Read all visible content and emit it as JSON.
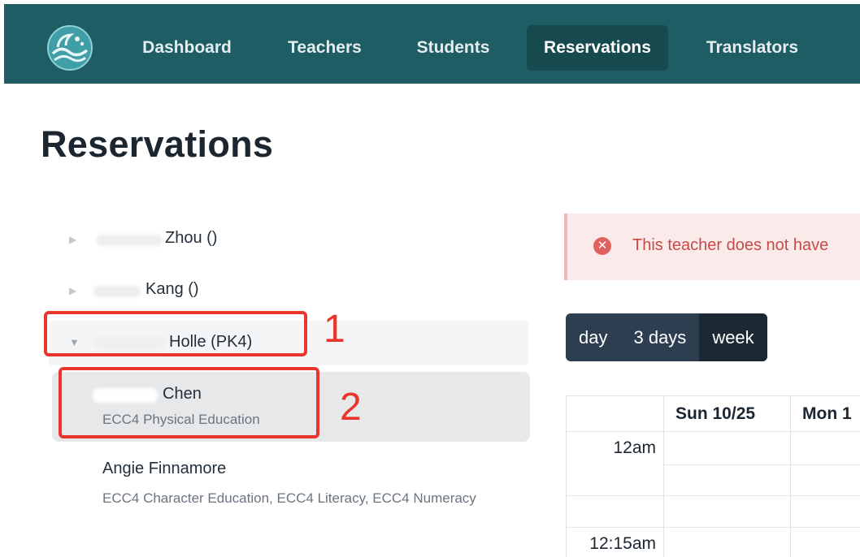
{
  "nav": {
    "items": [
      {
        "label": "Dashboard"
      },
      {
        "label": "Teachers"
      },
      {
        "label": "Students"
      },
      {
        "label": "Reservations",
        "active": true
      },
      {
        "label": "Translators"
      }
    ],
    "logo_icon": "wave-logo-icon",
    "bar_color": "#1d5d63"
  },
  "page": {
    "title": "Reservations"
  },
  "tree": {
    "rows": [
      {
        "name": "Zhou ()",
        "expanded": false
      },
      {
        "name": "Kang ()",
        "expanded": false
      },
      {
        "name": "Holle (PK4)",
        "expanded": true
      }
    ],
    "teachers": [
      {
        "name": "Chen",
        "subjects": "ECC4 Physical Education",
        "selected": true
      },
      {
        "name": "Angie Finnamore",
        "subjects": "ECC4 Character Education, ECC4 Literacy, ECC4 Numeracy"
      }
    ]
  },
  "annotations": {
    "one": "1",
    "two": "2",
    "color": "#e8362c"
  },
  "alert": {
    "text": "This teacher does not have",
    "icon": "error-circle-icon"
  },
  "calendar": {
    "views": [
      "day",
      "3 days",
      "week"
    ],
    "active_view": "week",
    "columns": [
      "Sun 10/25",
      "Mon 1"
    ],
    "times": [
      "12am",
      "12:15am"
    ]
  }
}
